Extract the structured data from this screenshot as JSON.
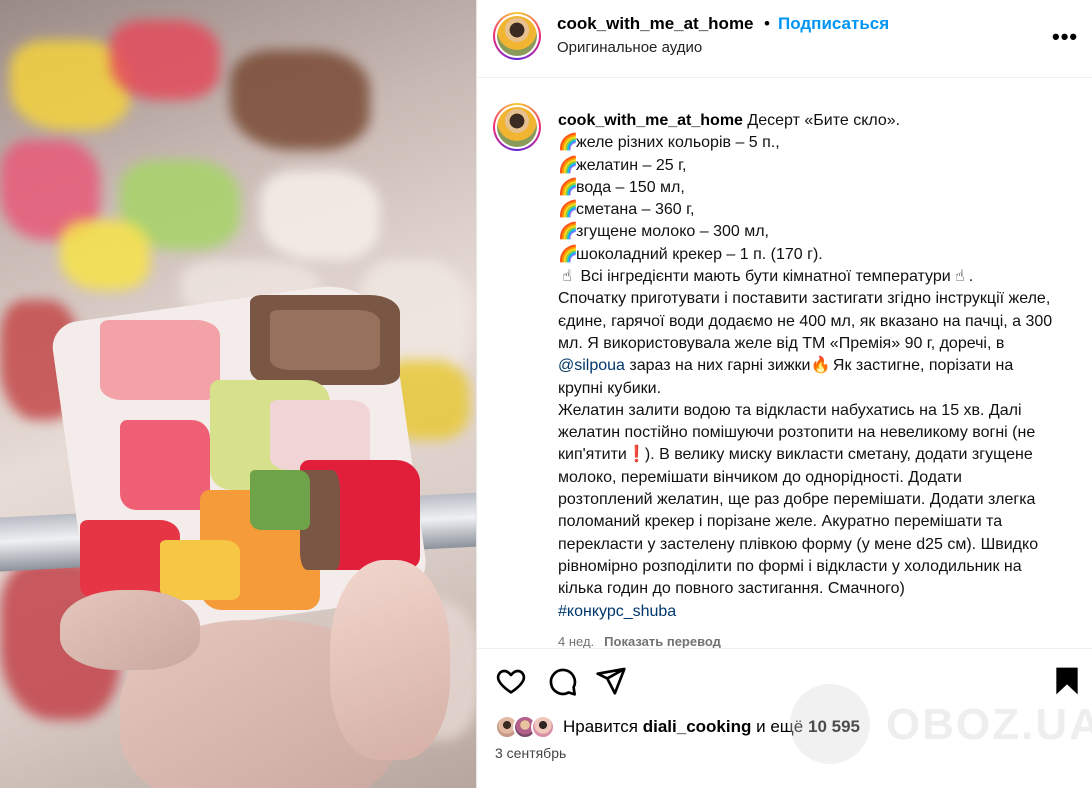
{
  "header": {
    "username": "cook_with_me_at_home",
    "dot": "•",
    "follow_label": "Подписаться",
    "audio": "Оригинальное аудио",
    "more_icon": "more-icon"
  },
  "caption": {
    "username": "cook_with_me_at_home",
    "title": "Десерт «Бите скло».",
    "ingredients": [
      {
        "icon": "rainbow",
        "text": "желе різних кольорів – 5 п.,"
      },
      {
        "icon": "rainbow",
        "text": "желатин – 25 г,"
      },
      {
        "icon": "rainbow",
        "text": "вода – 150 мл,"
      },
      {
        "icon": "rainbow",
        "text": "сметана – 360 г,"
      },
      {
        "icon": "rainbow",
        "text": "згущене молоко – 300 мл,"
      },
      {
        "icon": "rainbow",
        "text": "шоколадний крекер – 1 п. (170 г)."
      }
    ],
    "note_pre": "Всі інгредієнти мають бути кімнатної температури",
    "note_post": ".",
    "para1_a": "Спочатку приготувати і поставити застигати згідно інструкції желе, єдине, гарячої води додаємо не 400 мл, як вказано на пачці, а 300 мл. Я використовувала желе від ТМ «Премія» 90 г, доречі, в ",
    "mention": "@silpoua",
    "para1_b": " зараз на них гарні зижки",
    "para1_c": " Як застигне, порізати на крупні кубики.",
    "para2_a": "Желатин залити водою та відкласти набухатись на 15 хв. Далі желатин постійно помішуючи розтопити на невеликому вогні (не кип'ятити",
    "para2_b": "). В велику миску викласти сметану, додати згущене молоко, перемішати вінчиком до однорідності. Додати розтоплений желатин, ще раз добре перемішати. Додати злегка поломаний крекер і порізане желе. Акуратно перемішати та перекласти у застелену плівкою форму (у мене d25 см). Швидко рівномірно розподілити по формі і відкласти у холодильник на кілька годин до повного застигання. Смачного)",
    "hashtag": "#конкурс_shuba",
    "time_ago": "4 нед.",
    "translate": "Показать перевод"
  },
  "actions": {
    "like_icon": "heart-icon",
    "comment_icon": "comment-icon",
    "share_icon": "share-icon",
    "save_icon": "bookmark-icon"
  },
  "likes": {
    "prefix": "Нравится",
    "user": "diali_cooking",
    "middle": "и ещё",
    "count": "10 595"
  },
  "date": "3 сентябрь",
  "watermark": "OBOZ.UA",
  "colors": {
    "link": "#00376b",
    "follow": "#0095f6",
    "meta": "#737373"
  }
}
